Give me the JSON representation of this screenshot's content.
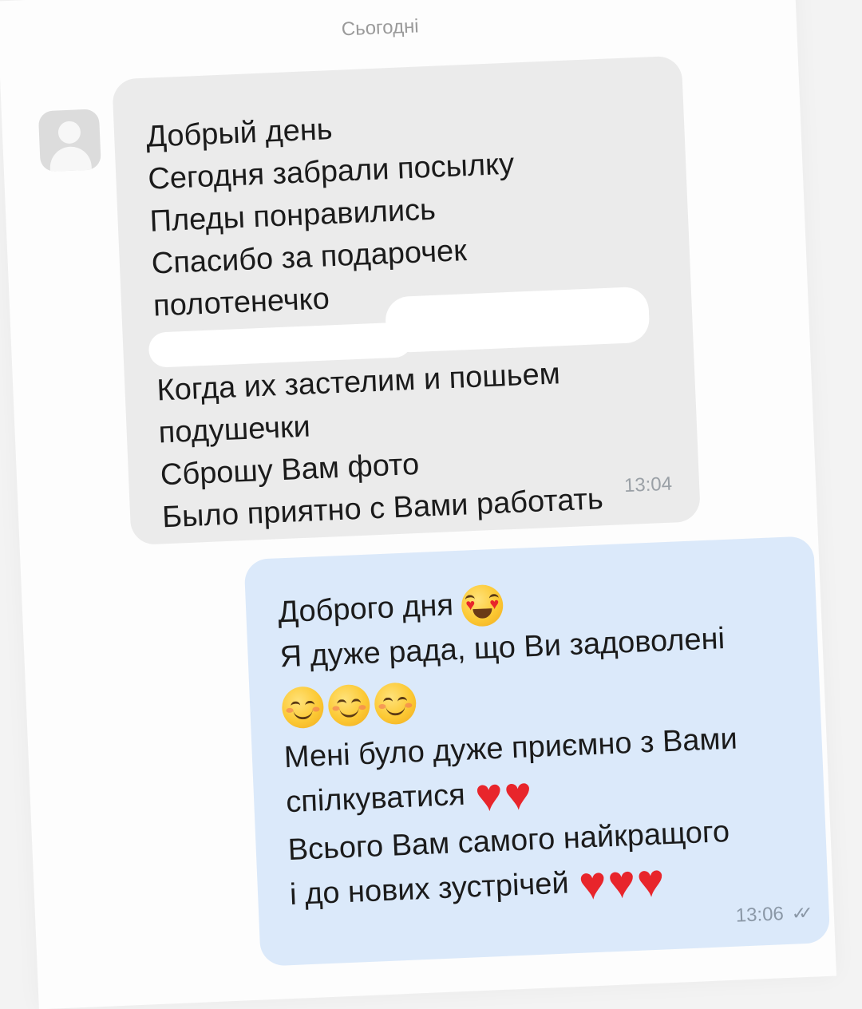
{
  "date_separator": "Сьогодні",
  "incoming": {
    "lines": [
      "Добрый день",
      "Сегодня забрали посылку",
      "Пледы понравились",
      "Спасибо за подарочек",
      "полотенечко",
      "Когда их застелим и пошьем",
      "подушечки",
      "Сброшу Вам фото",
      "Было приятно с Вами работать"
    ],
    "time": "13:04"
  },
  "outgoing": {
    "line1": "Доброго дня",
    "line2": "Я дуже рада, що Ви задоволені",
    "line3": "Мені було дуже приємно з Вами",
    "line4": "спілкуватися",
    "line5": "Всього Вам самого найкращого",
    "line6": "і до нових зустрічей",
    "time": "13:06",
    "status_icon": "double-check-icon"
  },
  "icons": {
    "avatar": "default-avatar-icon",
    "heart": "♥"
  },
  "colors": {
    "incoming_bubble": "#ebebeb",
    "outgoing_bubble": "#dbe9fa",
    "heart": "#e8252b"
  }
}
